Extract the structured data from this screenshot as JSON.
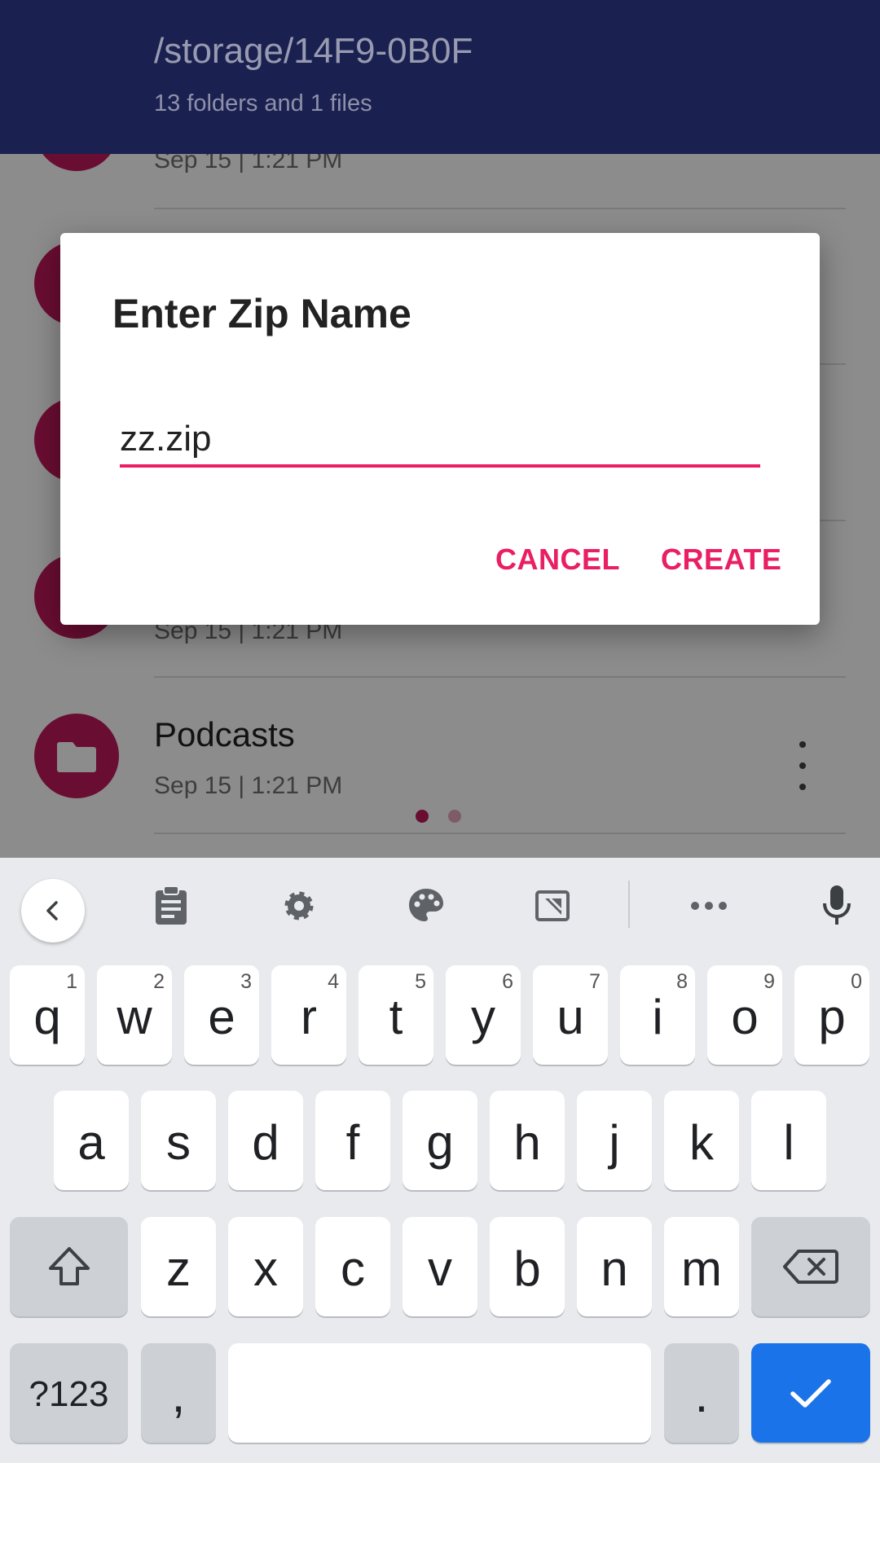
{
  "app_bar": {
    "path": "/storage/14F9-0B0F",
    "summary": "13 folders and 1 files"
  },
  "files": [
    {
      "name": "",
      "date": "Sep 15 | 1:21 PM"
    },
    {
      "name": "",
      "date": ""
    },
    {
      "name": "",
      "date": ""
    },
    {
      "name": "",
      "date": "Sep 15 | 1:21 PM"
    },
    {
      "name": "Podcasts",
      "date": "Sep 15 | 1:21 PM"
    }
  ],
  "pager": {
    "pages": 2,
    "active_page": 1
  },
  "dialog": {
    "title": "Enter Zip Name",
    "input_value": "zz.zip",
    "cancel_label": "CANCEL",
    "create_label": "CREATE"
  },
  "keyboard": {
    "toolbar": [
      "back-icon",
      "clipboard-icon",
      "settings-icon",
      "palette-icon",
      "resize-icon",
      "more-icon",
      "mic-icon"
    ],
    "row1": [
      {
        "k": "q",
        "h": "1"
      },
      {
        "k": "w",
        "h": "2"
      },
      {
        "k": "e",
        "h": "3"
      },
      {
        "k": "r",
        "h": "4"
      },
      {
        "k": "t",
        "h": "5"
      },
      {
        "k": "y",
        "h": "6"
      },
      {
        "k": "u",
        "h": "7"
      },
      {
        "k": "i",
        "h": "8"
      },
      {
        "k": "o",
        "h": "9"
      },
      {
        "k": "p",
        "h": "0"
      }
    ],
    "row2": [
      "a",
      "s",
      "d",
      "f",
      "g",
      "h",
      "j",
      "k",
      "l"
    ],
    "row3": [
      "z",
      "x",
      "c",
      "v",
      "b",
      "n",
      "m"
    ],
    "symbols_label": "?123",
    "comma_label": ",",
    "period_label": "."
  },
  "colors": {
    "app_bar": "#1a2151",
    "accent": "#e91e63",
    "folder": "#c2185b",
    "enter_key": "#1a73e8"
  }
}
